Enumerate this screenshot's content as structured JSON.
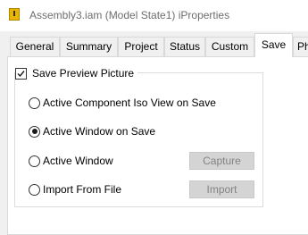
{
  "window": {
    "title": "Assembly3.iam (Model State1) iProperties",
    "icon": "inventor-assembly-icon"
  },
  "tabs": [
    {
      "label": "General"
    },
    {
      "label": "Summary"
    },
    {
      "label": "Project"
    },
    {
      "label": "Status"
    },
    {
      "label": "Custom"
    },
    {
      "label": "Save",
      "active": true
    },
    {
      "label": "Ph"
    }
  ],
  "save_preview": {
    "label": "Save Preview Picture",
    "checked": true,
    "options": [
      {
        "label": "Active Component Iso View on Save",
        "selected": false
      },
      {
        "label": "Active Window on Save",
        "selected": true
      },
      {
        "label": "Active Window",
        "selected": false,
        "button": "Capture"
      },
      {
        "label": "Import From File",
        "selected": false,
        "button": "Import"
      }
    ]
  }
}
